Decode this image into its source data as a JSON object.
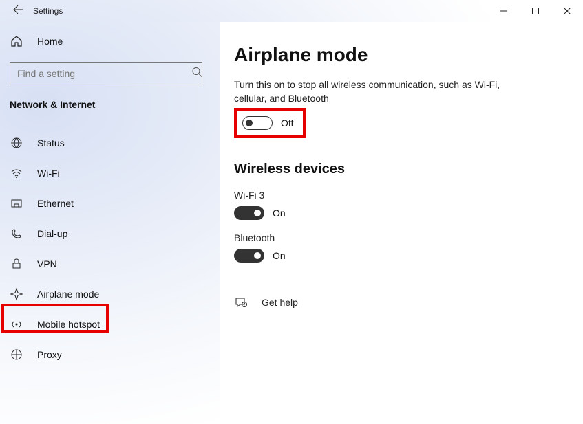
{
  "titlebar": {
    "title": "Settings"
  },
  "sidebar": {
    "home": "Home",
    "search_placeholder": "Find a setting",
    "category": "Network & Internet",
    "items": [
      {
        "label": "Status"
      },
      {
        "label": "Wi-Fi"
      },
      {
        "label": "Ethernet"
      },
      {
        "label": "Dial-up"
      },
      {
        "label": "VPN"
      },
      {
        "label": "Airplane mode"
      },
      {
        "label": "Mobile hotspot"
      },
      {
        "label": "Proxy"
      }
    ]
  },
  "main": {
    "title": "Airplane mode",
    "description": "Turn this on to stop all wireless communication, such as Wi-Fi, cellular, and Bluetooth",
    "airplane_toggle": {
      "state": "off",
      "label": "Off"
    },
    "section_wireless": "Wireless devices",
    "devices": [
      {
        "name": "Wi-Fi 3",
        "state": "on",
        "label": "On"
      },
      {
        "name": "Bluetooth",
        "state": "on",
        "label": "On"
      }
    ],
    "help": "Get help"
  }
}
